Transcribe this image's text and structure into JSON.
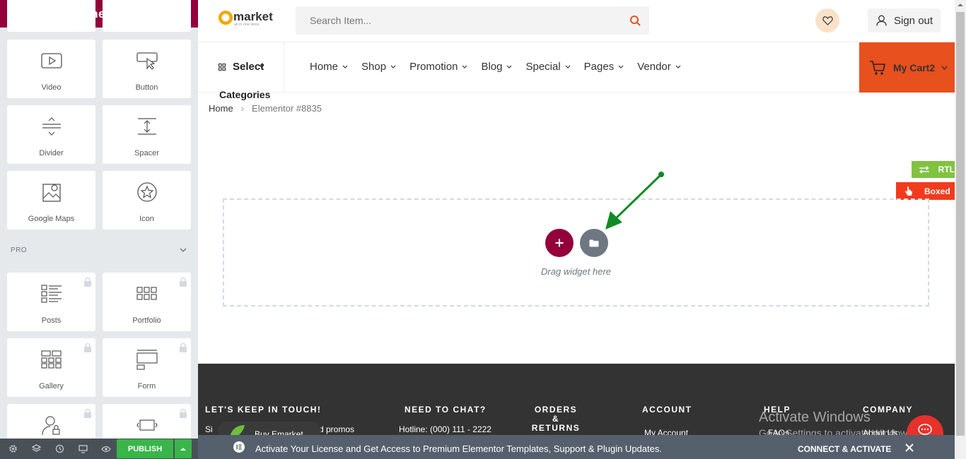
{
  "editor": {
    "title": "elementor",
    "widgets": [
      {
        "label": "Video",
        "icon": "video-icon",
        "locked": false
      },
      {
        "label": "Button",
        "icon": "button-icon",
        "locked": false
      },
      {
        "label": "Divider",
        "icon": "divider-icon",
        "locked": false
      },
      {
        "label": "Spacer",
        "icon": "spacer-icon",
        "locked": false
      },
      {
        "label": "Google Maps",
        "icon": "google-maps-icon",
        "locked": false
      },
      {
        "label": "Icon",
        "icon": "star-icon",
        "locked": false
      }
    ],
    "pro_section": "PRO",
    "pro_widgets": [
      {
        "label": "Posts",
        "icon": "posts-icon",
        "locked": true
      },
      {
        "label": "Portfolio",
        "icon": "portfolio-icon",
        "locked": true
      },
      {
        "label": "Gallery",
        "icon": "gallery-icon",
        "locked": true
      },
      {
        "label": "Form",
        "icon": "form-icon",
        "locked": true
      },
      {
        "label": "",
        "icon": "login-icon",
        "locked": true
      },
      {
        "label": "",
        "icon": "slides-icon",
        "locked": true
      }
    ],
    "footer": {
      "publish_label": "PUBLISH"
    }
  },
  "site": {
    "logo_text": "market",
    "logo_tagline": "all in one store",
    "search_placeholder": "Search Item...",
    "signout_label": "Sign out",
    "categories_line1": "Select",
    "categories_line2": "Categories",
    "menu": [
      "Home",
      "Shop",
      "Promotion",
      "Blog",
      "Special",
      "Pages",
      "Vendor"
    ],
    "cart_label": "My Cart2",
    "breadcrumb": {
      "home": "Home",
      "current": "Elementor #8835"
    },
    "rtl_label": "RTL",
    "boxed_label": "Boxed",
    "drag_text": "Drag widget here"
  },
  "footer": {
    "col1_title": "LET'S KEEP IN TOUCH!",
    "col1_text_a": "Si",
    "col1_text_b": "d promos",
    "buy_label": "Buy Emarket",
    "col2_title": "NEED TO CHAT?",
    "col2_text": "Hotline: (000) 111 - 2222",
    "col3_title_1": "ORDERS &",
    "col3_title_2": "RETURNS",
    "col4_title": "ACCOUNT",
    "col4_link": "My Account",
    "col5_title": "HELP",
    "col5_link": "FAQs",
    "col6_title": "COMPANY",
    "col6_link": "About Us"
  },
  "watermark": {
    "line1": "Activate Windows",
    "line2": "Go to Settings to activate Windows."
  },
  "notice": {
    "message": "Activate Your License and Get Access to Premium Elementor Templates, Support & Plugin Updates.",
    "cta": "CONNECT & ACTIVATE"
  },
  "colors": {
    "brand": "#93003c",
    "accent": "#e8501d",
    "publish": "#39b54a"
  }
}
